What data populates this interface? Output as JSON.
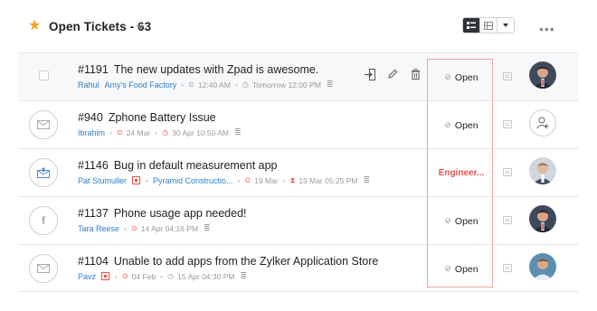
{
  "header": {
    "title": "Open Tickets - 63",
    "more_label": "•••"
  },
  "tickets": [
    {
      "id": "#1191",
      "subject": "The new updates with Zpad is awesome.",
      "contact": "Rahul",
      "account": "Amy's Food Factory",
      "time1": "12:40 AM",
      "time2": "Tomorrow 12:00 PM",
      "status": "Open",
      "channel": "none"
    },
    {
      "id": "#940",
      "subject": "Zphone Battery Issue",
      "contact": "Ibrahim",
      "time1": "24 Mar",
      "time2": "30 Apr 10:50 AM",
      "status": "Open",
      "channel": "email"
    },
    {
      "id": "#1146",
      "subject": "Bug in default measurement app",
      "contact": "Pat Stumuller",
      "account": "Pyramid Constructio...",
      "time1": "19 Mar",
      "time2": "19 Mar 05:25 PM",
      "status": "Engineer...",
      "channel": "web"
    },
    {
      "id": "#1137",
      "subject": "Phone usage app needed!",
      "contact": "Tara Reese",
      "time1": "14 Apr 04:16 PM",
      "status": "Open",
      "channel": "facebook"
    },
    {
      "id": "#1104",
      "subject": "Unable to add apps from the Zylker Application Store",
      "contact": "Pavz",
      "time1": "04 Feb",
      "time2": "15 Apr 04:30 PM",
      "status": "Open",
      "channel": "email"
    }
  ],
  "colors": {
    "accent_star": "#f5a623",
    "link": "#2d7ecb",
    "alert": "#e5534b",
    "highlight_box": "#f0a3a3"
  }
}
